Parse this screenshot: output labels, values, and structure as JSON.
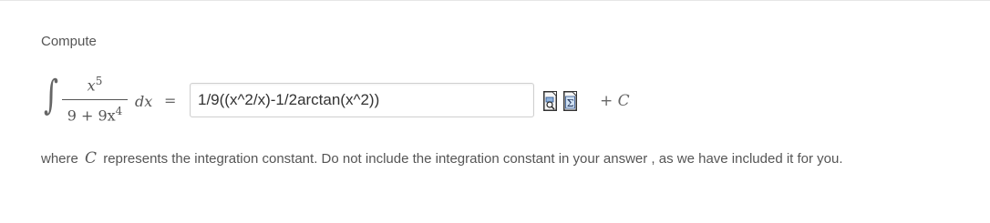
{
  "prompt": {
    "label": "Compute"
  },
  "integral": {
    "sign": "∫",
    "numerator_base": "x",
    "numerator_exp": "5",
    "denominator_text": "9 + 9x",
    "denominator_exp": "4",
    "differential": "dx",
    "equals": "="
  },
  "answer": {
    "value": "1/9((x^2/x)-1/2arctan(x^2))",
    "placeholder": ""
  },
  "toolbar": {
    "icons": [
      "preview-icon",
      "sigma-icon"
    ]
  },
  "constant": {
    "plus": "+",
    "symbol": "C"
  },
  "footer": {
    "prefix": "where",
    "symbol": "C",
    "suffix": "represents the integration constant. Do not include the integration constant in your answer , as we have included it for you."
  }
}
